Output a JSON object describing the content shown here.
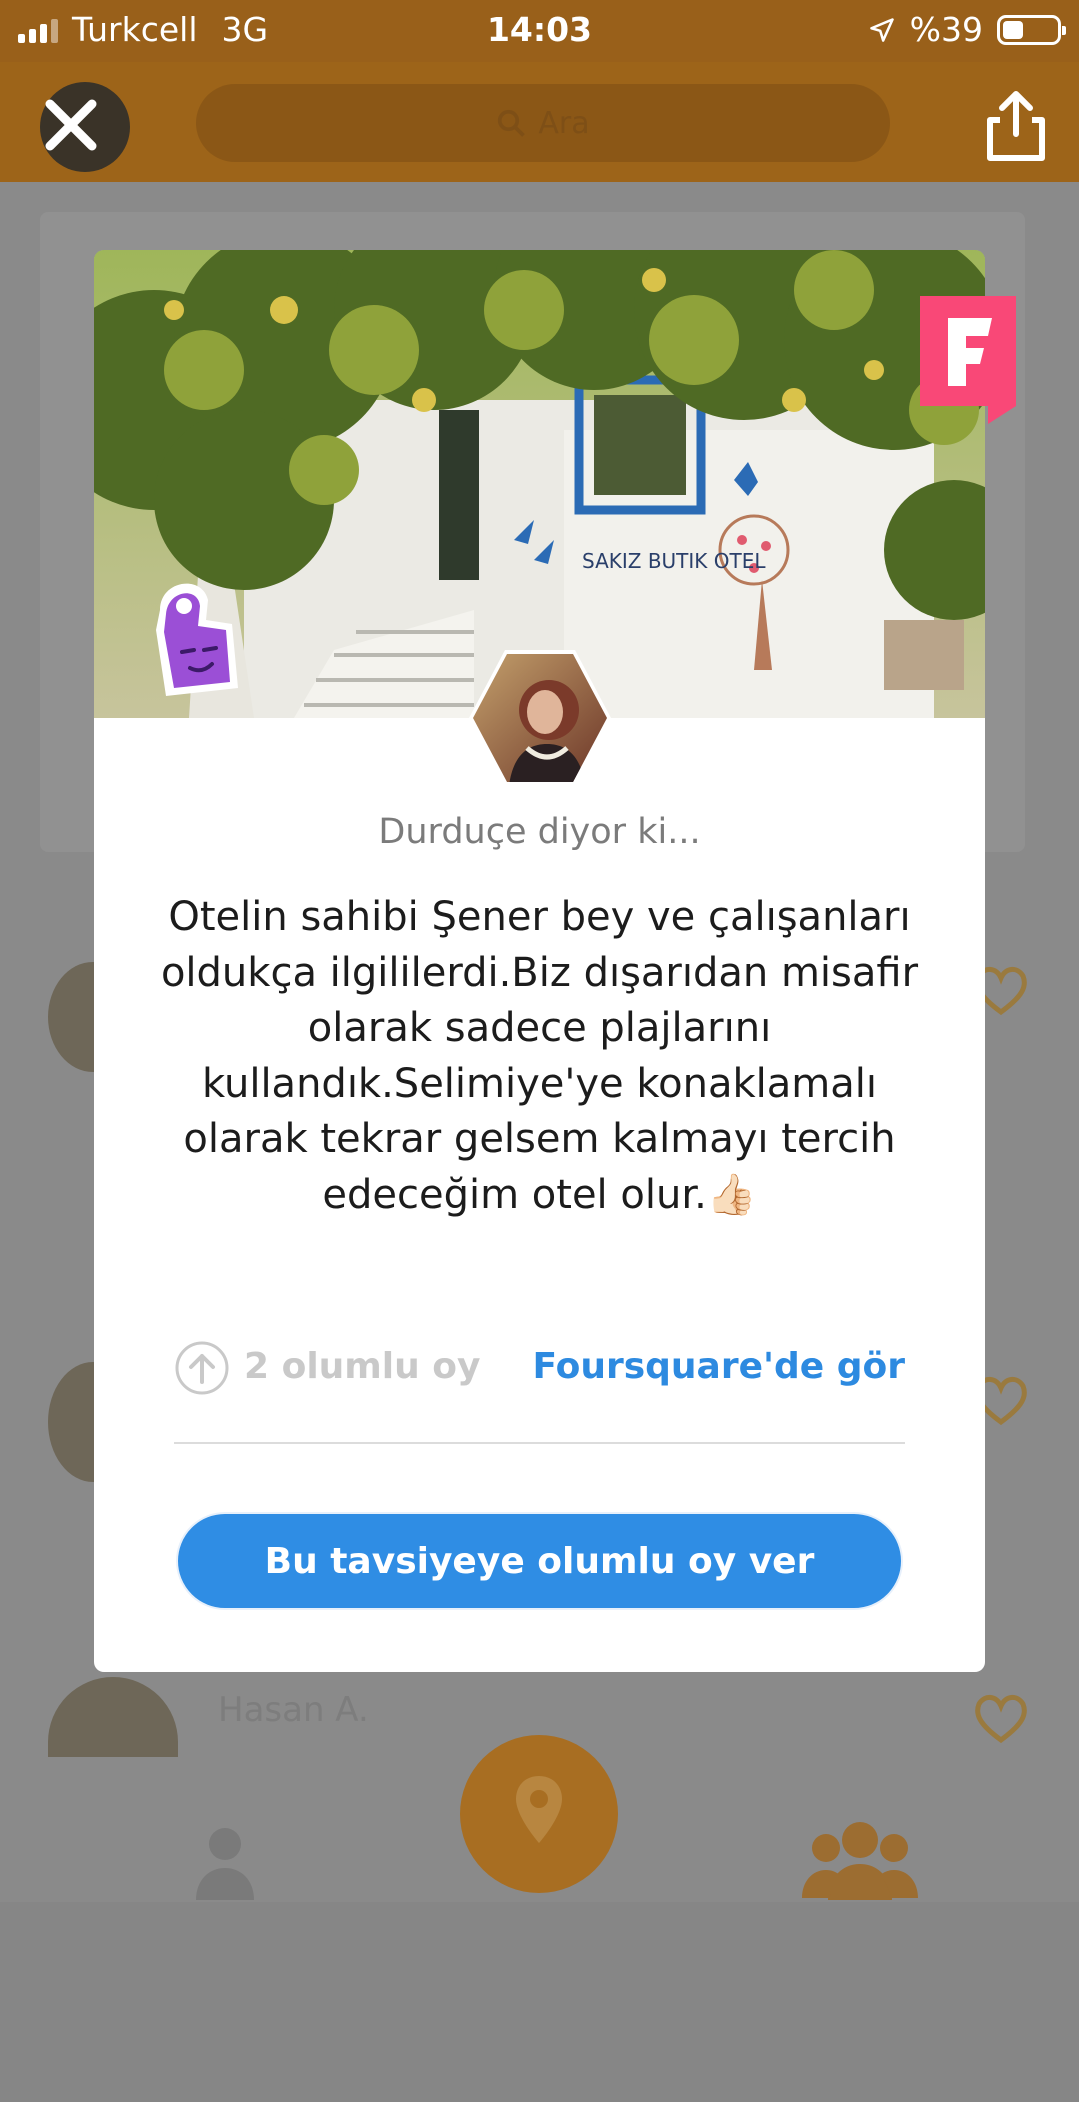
{
  "status_bar": {
    "carrier": "Turkcell",
    "network": "3G",
    "time": "14:03",
    "battery": "%39",
    "battery_level": 0.39
  },
  "navbar": {
    "search_placeholder": "Ara",
    "close_icon": "close-icon",
    "share_icon": "share-icon"
  },
  "background": {
    "list_user_name": "Hasan A."
  },
  "tip_card": {
    "author_line": "Durduçe diyor ki...",
    "text": "Otelin sahibi Şener bey ve çalışanları oldukça ilgililerdi.Biz dışarıdan misafir olarak sadece plajlarını kullandık.Selimiye'ye konaklamalı olarak tekrar gelsem kalmayı tercih edeceğim otel olur.👍🏻",
    "upvote_count": "2 olumlu oy",
    "foursquare_link": "Foursquare'de gör",
    "upvote_button": "Bu tavsiyeye olumlu oy ver",
    "photo_sign": "SAKIZ BUTIK OTEL",
    "colors": {
      "accent_blue": "#2f8de4",
      "foursquare_pink": "#f94877",
      "sticker_purple": "#9b4fd6"
    }
  }
}
